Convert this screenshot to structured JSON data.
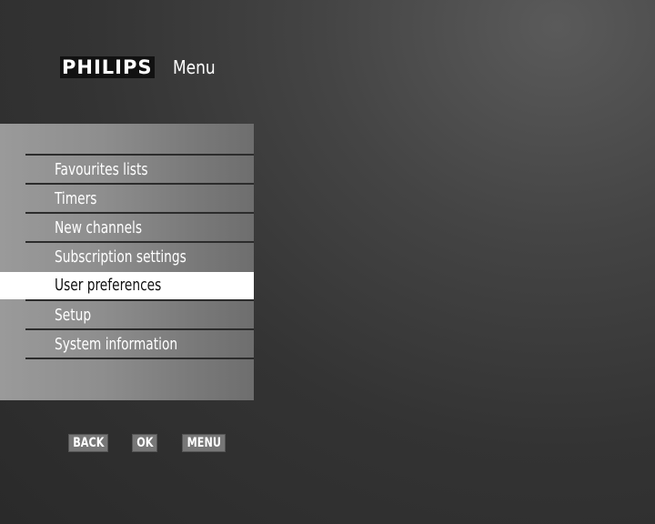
{
  "header": {
    "brand": "PHILIPS",
    "title": "Menu"
  },
  "menu": {
    "items": [
      {
        "label": "Favourites lists",
        "selected": false
      },
      {
        "label": "Timers",
        "selected": false
      },
      {
        "label": "New channels",
        "selected": false
      },
      {
        "label": "Subscription settings",
        "selected": false
      },
      {
        "label": "User preferences",
        "selected": true
      },
      {
        "label": "Setup",
        "selected": false
      },
      {
        "label": "System information",
        "selected": false
      }
    ]
  },
  "buttons": {
    "back": "BACK",
    "ok": "OK",
    "menu": "MENU"
  }
}
